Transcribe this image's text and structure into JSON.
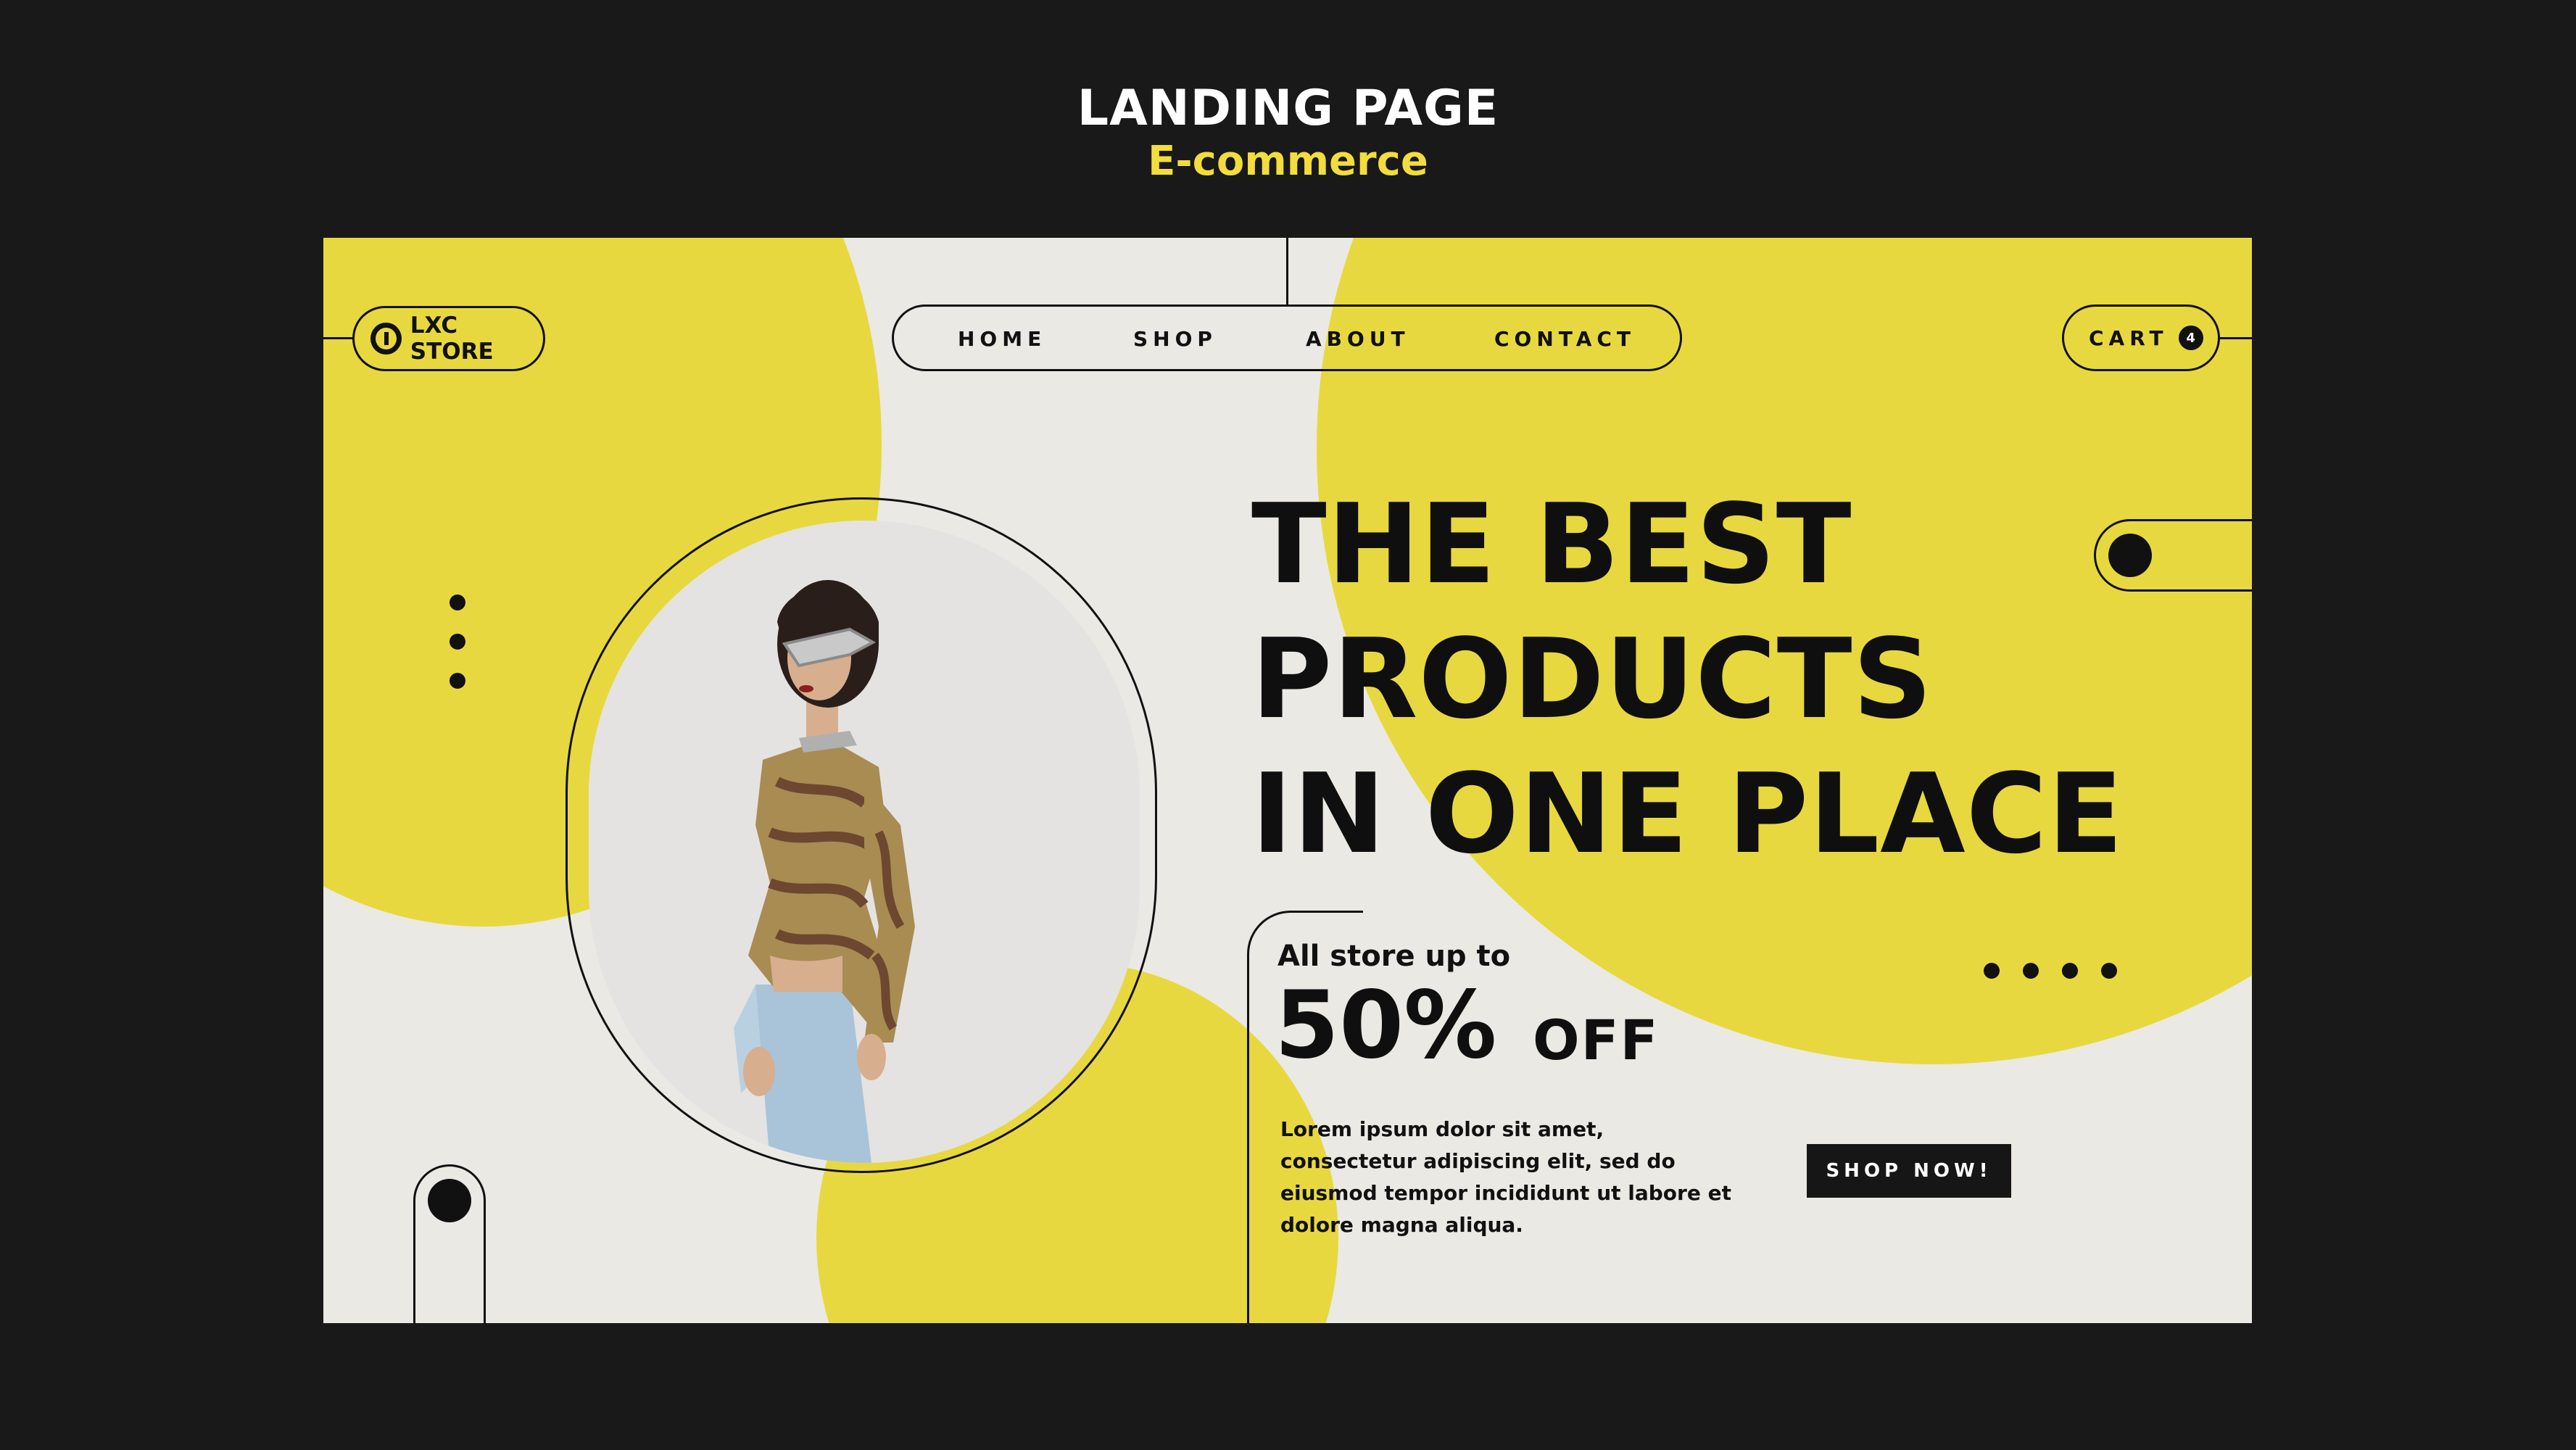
{
  "header": {
    "title": "LANDING PAGE",
    "subtitle": "E-commerce"
  },
  "brand": {
    "name": "LXC STORE"
  },
  "nav": {
    "items": [
      "HOME",
      "SHOP",
      "ABOUT",
      "CONTACT"
    ]
  },
  "cart": {
    "label": "CART",
    "count": "4"
  },
  "hero": {
    "headline": [
      "THE BEST",
      "PRODUCTS",
      "IN ONE PLACE"
    ]
  },
  "promo": {
    "intro": "All store up to",
    "amount": "50%",
    "suffix": "OFF",
    "body": "Lorem ipsum dolor sit amet, consectetur adipiscing elit, sed do eiusmod tempor incididunt ut labore et dolore magna aliqua.",
    "cta": "SHOP NOW!"
  },
  "colors": {
    "background": "#191919",
    "accent": "#e8d83f",
    "subtitle": "#f2dd3c",
    "canvas": "#ebe9e4",
    "ink": "#111111"
  }
}
